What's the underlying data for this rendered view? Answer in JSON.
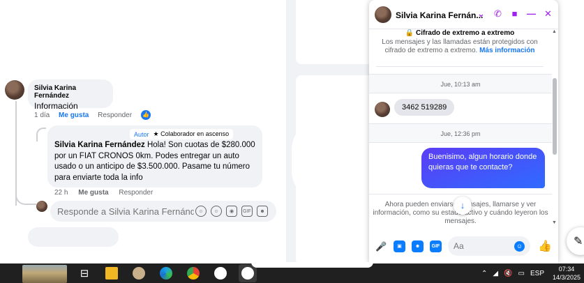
{
  "comments": {
    "first": {
      "author": "Silvia Karina Fernández",
      "text": "Información",
      "time": "1 día",
      "like_label": "Me gusta",
      "reply_label": "Responder"
    },
    "reply": {
      "badge_author": "Autor",
      "badge_collab": "Colaborador en ascenso",
      "author": "Silvia Karina Fernández",
      "text": "Hola! Son cuotas de $280.000 por un FIAT CRONOS 0km. Podes entregar un auto usado o un anticipo de $3.500.000. Pasame tu número para enviarte toda la info",
      "time": "22 h",
      "like_label": "Me gusta",
      "reply_label": "Responder"
    },
    "reply_input": {
      "placeholder": "Responde a Silvia Karina Fernánd..."
    }
  },
  "chat": {
    "contact_name": "Silvia Karina Fernán...",
    "encryption": {
      "title": "Cifrado de extremo a extremo",
      "text": "Los mensajes y las llamadas están protegidos con cifrado de extremo a extremo.",
      "more": "Más información"
    },
    "timestamp_1": "Jue, 10:13 am",
    "incoming_message": "3462 519289",
    "timestamp_2": "Jue, 12:36 pm",
    "outgoing_message": "Buenisimo, algun horario donde quieras que te contacte?",
    "info_notice": "Ahora pueden enviarse mensajes, llamarse y ver información, como su estado activo y cuándo leyeron los mensajes.",
    "input_placeholder": "Aa",
    "accent_color": "#0a7cff",
    "header_icon_color": "#a020f0"
  },
  "taskbar": {
    "language": "ESP",
    "time": "07:34",
    "date": "14/3/2025"
  }
}
